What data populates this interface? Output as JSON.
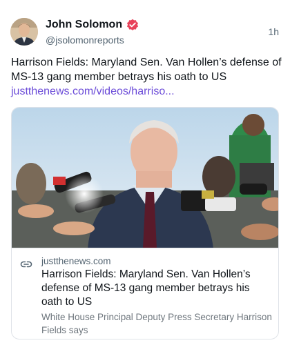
{
  "author": {
    "name": "John Solomon",
    "handle": "@jsolomonreports",
    "verified": true,
    "time": "1h"
  },
  "post": {
    "text": "Harrison Fields: Maryland Sen. Van Hollen’s defense of MS-13 gang member betrays his oath to US",
    "link_text": "justthenews.com/videos/harriso..."
  },
  "card": {
    "domain": "justthenews.com",
    "title": "Harrison Fields: Maryland Sen. Van Hollen’s defense of MS-13 gang member betrays his oath to US",
    "description": "White House Principal Deputy Press Secretary Harrison Fields says"
  },
  "colors": {
    "link": "#6b4bd8",
    "verified_badge": "#e8425a",
    "secondary_text": "#536471"
  },
  "icons": {
    "verified": "verified-badge-icon",
    "link": "link-icon"
  }
}
